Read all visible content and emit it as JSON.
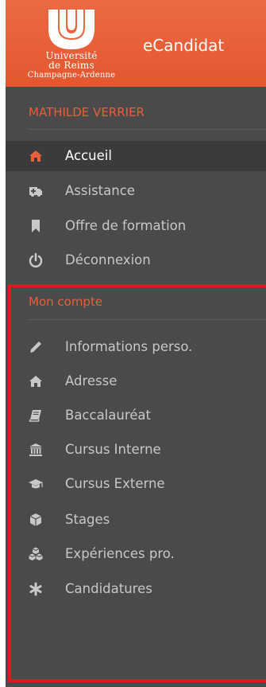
{
  "header": {
    "logo": {
      "line1": "Université",
      "line2": "de Reims",
      "line3": "Champagne-Ardenne"
    },
    "app_title": "eCandidat"
  },
  "sidebar": {
    "user_name": "MATHILDE VERRIER",
    "main_items": [
      {
        "label": "Accueil",
        "icon": "home-icon",
        "active": true
      },
      {
        "label": "Assistance",
        "icon": "ambulance-icon",
        "active": false
      },
      {
        "label": "Offre de formation",
        "icon": "bookmark-icon",
        "active": false
      },
      {
        "label": "Déconnexion",
        "icon": "power-icon",
        "active": false
      }
    ],
    "account_section_title": "Mon compte",
    "account_items": [
      {
        "label": "Informations perso.",
        "icon": "pencil-icon"
      },
      {
        "label": "Adresse",
        "icon": "home-icon"
      },
      {
        "label": "Baccalauréat",
        "icon": "book-icon"
      },
      {
        "label": "Cursus Interne",
        "icon": "institution-icon"
      },
      {
        "label": "Cursus Externe",
        "icon": "graduation-cap-icon"
      },
      {
        "label": "Stages",
        "icon": "cube-icon"
      },
      {
        "label": "Expériences pro.",
        "icon": "cubes-icon"
      },
      {
        "label": "Candidatures",
        "icon": "asterisk-icon"
      }
    ]
  },
  "colors": {
    "header_bg": "#e8603a",
    "sidebar_bg": "#4a4a4a",
    "accent": "#e8603a",
    "highlight_border": "#e8141e"
  }
}
